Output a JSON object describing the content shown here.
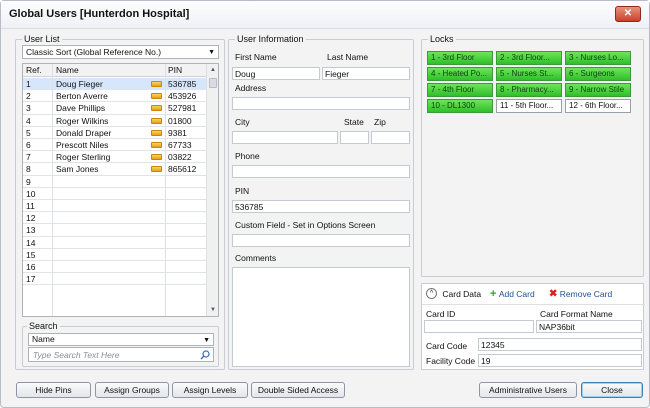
{
  "window": {
    "title": "Global Users [Hunterdon Hospital]",
    "close_glyph": "✕"
  },
  "user_list": {
    "group_label": "User List",
    "sort_value": "Classic Sort (Global Reference No.)",
    "columns": [
      "Ref.",
      "Name",
      "PIN"
    ],
    "rows": [
      {
        "ref": "1",
        "name": "Doug Fieger",
        "pin": "536785"
      },
      {
        "ref": "2",
        "name": "Berton Averre",
        "pin": "453926"
      },
      {
        "ref": "3",
        "name": "Dave Phillips",
        "pin": "527981"
      },
      {
        "ref": "4",
        "name": "Roger Wilkins",
        "pin": "01800"
      },
      {
        "ref": "5",
        "name": "Donald Draper",
        "pin": "9381"
      },
      {
        "ref": "6",
        "name": "Prescott Niles",
        "pin": "67733"
      },
      {
        "ref": "7",
        "name": "Roger Sterling",
        "pin": "03822"
      },
      {
        "ref": "8",
        "name": "Sam Jones",
        "pin": "865612"
      },
      {
        "ref": "9",
        "name": "",
        "pin": ""
      },
      {
        "ref": "10",
        "name": "",
        "pin": ""
      },
      {
        "ref": "11",
        "name": "",
        "pin": ""
      },
      {
        "ref": "12",
        "name": "",
        "pin": ""
      },
      {
        "ref": "13",
        "name": "",
        "pin": ""
      },
      {
        "ref": "14",
        "name": "",
        "pin": ""
      },
      {
        "ref": "15",
        "name": "",
        "pin": ""
      },
      {
        "ref": "16",
        "name": "",
        "pin": ""
      },
      {
        "ref": "17",
        "name": "",
        "pin": ""
      }
    ],
    "selected_row": 0
  },
  "search": {
    "group_label": "Search",
    "field_value": "Name",
    "placeholder": "Type Search Text Here"
  },
  "user_info": {
    "group_label": "User Information",
    "first_name_label": "First Name",
    "first_name": "Doug",
    "last_name_label": "Last Name",
    "last_name": "Fieger",
    "address_label": "Address",
    "address": "",
    "city_label": "City",
    "city": "",
    "state_label": "State",
    "state": "",
    "zip_label": "Zip",
    "zip": "",
    "phone_label": "Phone",
    "phone": "",
    "pin_label": "PIN",
    "pin": "536785",
    "custom_label": "Custom Field - Set in Options Screen",
    "custom": "",
    "comments_label": "Comments",
    "comments": ""
  },
  "locks": {
    "group_label": "Locks",
    "items": [
      {
        "label": "1 - 3rd Floor",
        "active": true
      },
      {
        "label": "2 - 3rd Floor...",
        "active": true
      },
      {
        "label": "3 - Nurses Lo...",
        "active": true
      },
      {
        "label": "4 - Heated Po...",
        "active": true
      },
      {
        "label": "5 - Nurses St...",
        "active": true
      },
      {
        "label": "6 - Surgeons",
        "active": true
      },
      {
        "label": "7 - 4th Floor",
        "active": true
      },
      {
        "label": "8 - Pharmacy...",
        "active": true
      },
      {
        "label": "9 - Narrow Stile",
        "active": true
      },
      {
        "label": "10 - DL1300",
        "active": true
      },
      {
        "label": "11 - 5th Floor...",
        "active": false
      },
      {
        "label": "12 - 6th Floor...",
        "active": false
      }
    ]
  },
  "cards": {
    "toggle_label": "Card Data",
    "add_label": "Add Card",
    "remove_label": "Remove Card",
    "col_id": "Card ID",
    "col_format": "Card Format Name",
    "card_id": "",
    "card_format": "NAP36bit",
    "card_code_label": "Card Code",
    "card_code": "12345",
    "facility_code_label": "Facility Code",
    "facility_code": "19"
  },
  "buttons": {
    "hide_pins": "Hide Pins",
    "assign_groups": "Assign Groups",
    "assign_levels": "Assign Levels",
    "double_sided": "Double Sided Access",
    "admin_users": "Administrative Users",
    "close": "Close"
  },
  "colors": {
    "lock_active": "#2fbf2a",
    "selection": "#d6e6fb",
    "close_red": "#c7432c"
  }
}
